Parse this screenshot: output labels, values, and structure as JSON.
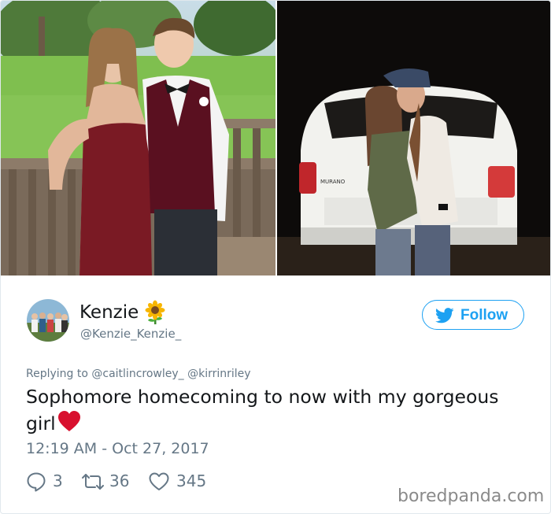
{
  "tweet": {
    "photos": [
      {
        "name": "prom-photo"
      },
      {
        "name": "night-car-photo"
      }
    ],
    "author": {
      "display_name": "Kenzie",
      "emoji_icon": "sunflower-icon",
      "handle": "@Kenzie_Kenzie_"
    },
    "follow_button": {
      "label": "Follow",
      "icon": "twitter-bird-icon",
      "color": "#1da1f2"
    },
    "replying_to": {
      "prefix": "Replying to",
      "mentions": [
        "@caitlincrowley_",
        "@kirrinriley"
      ]
    },
    "text": "Sophomore homecoming to now with my gorgeous girl",
    "text_emoji_icon": "red-heart-icon",
    "timestamp": "12:19 AM - Oct 27, 2017",
    "actions": {
      "replies": "3",
      "retweets": "36",
      "likes": "345"
    }
  },
  "watermark": "boredpanda.com",
  "colors": {
    "text": "#14171a",
    "muted": "#657786",
    "accent": "#1da1f2",
    "heart": "#e0245e"
  }
}
